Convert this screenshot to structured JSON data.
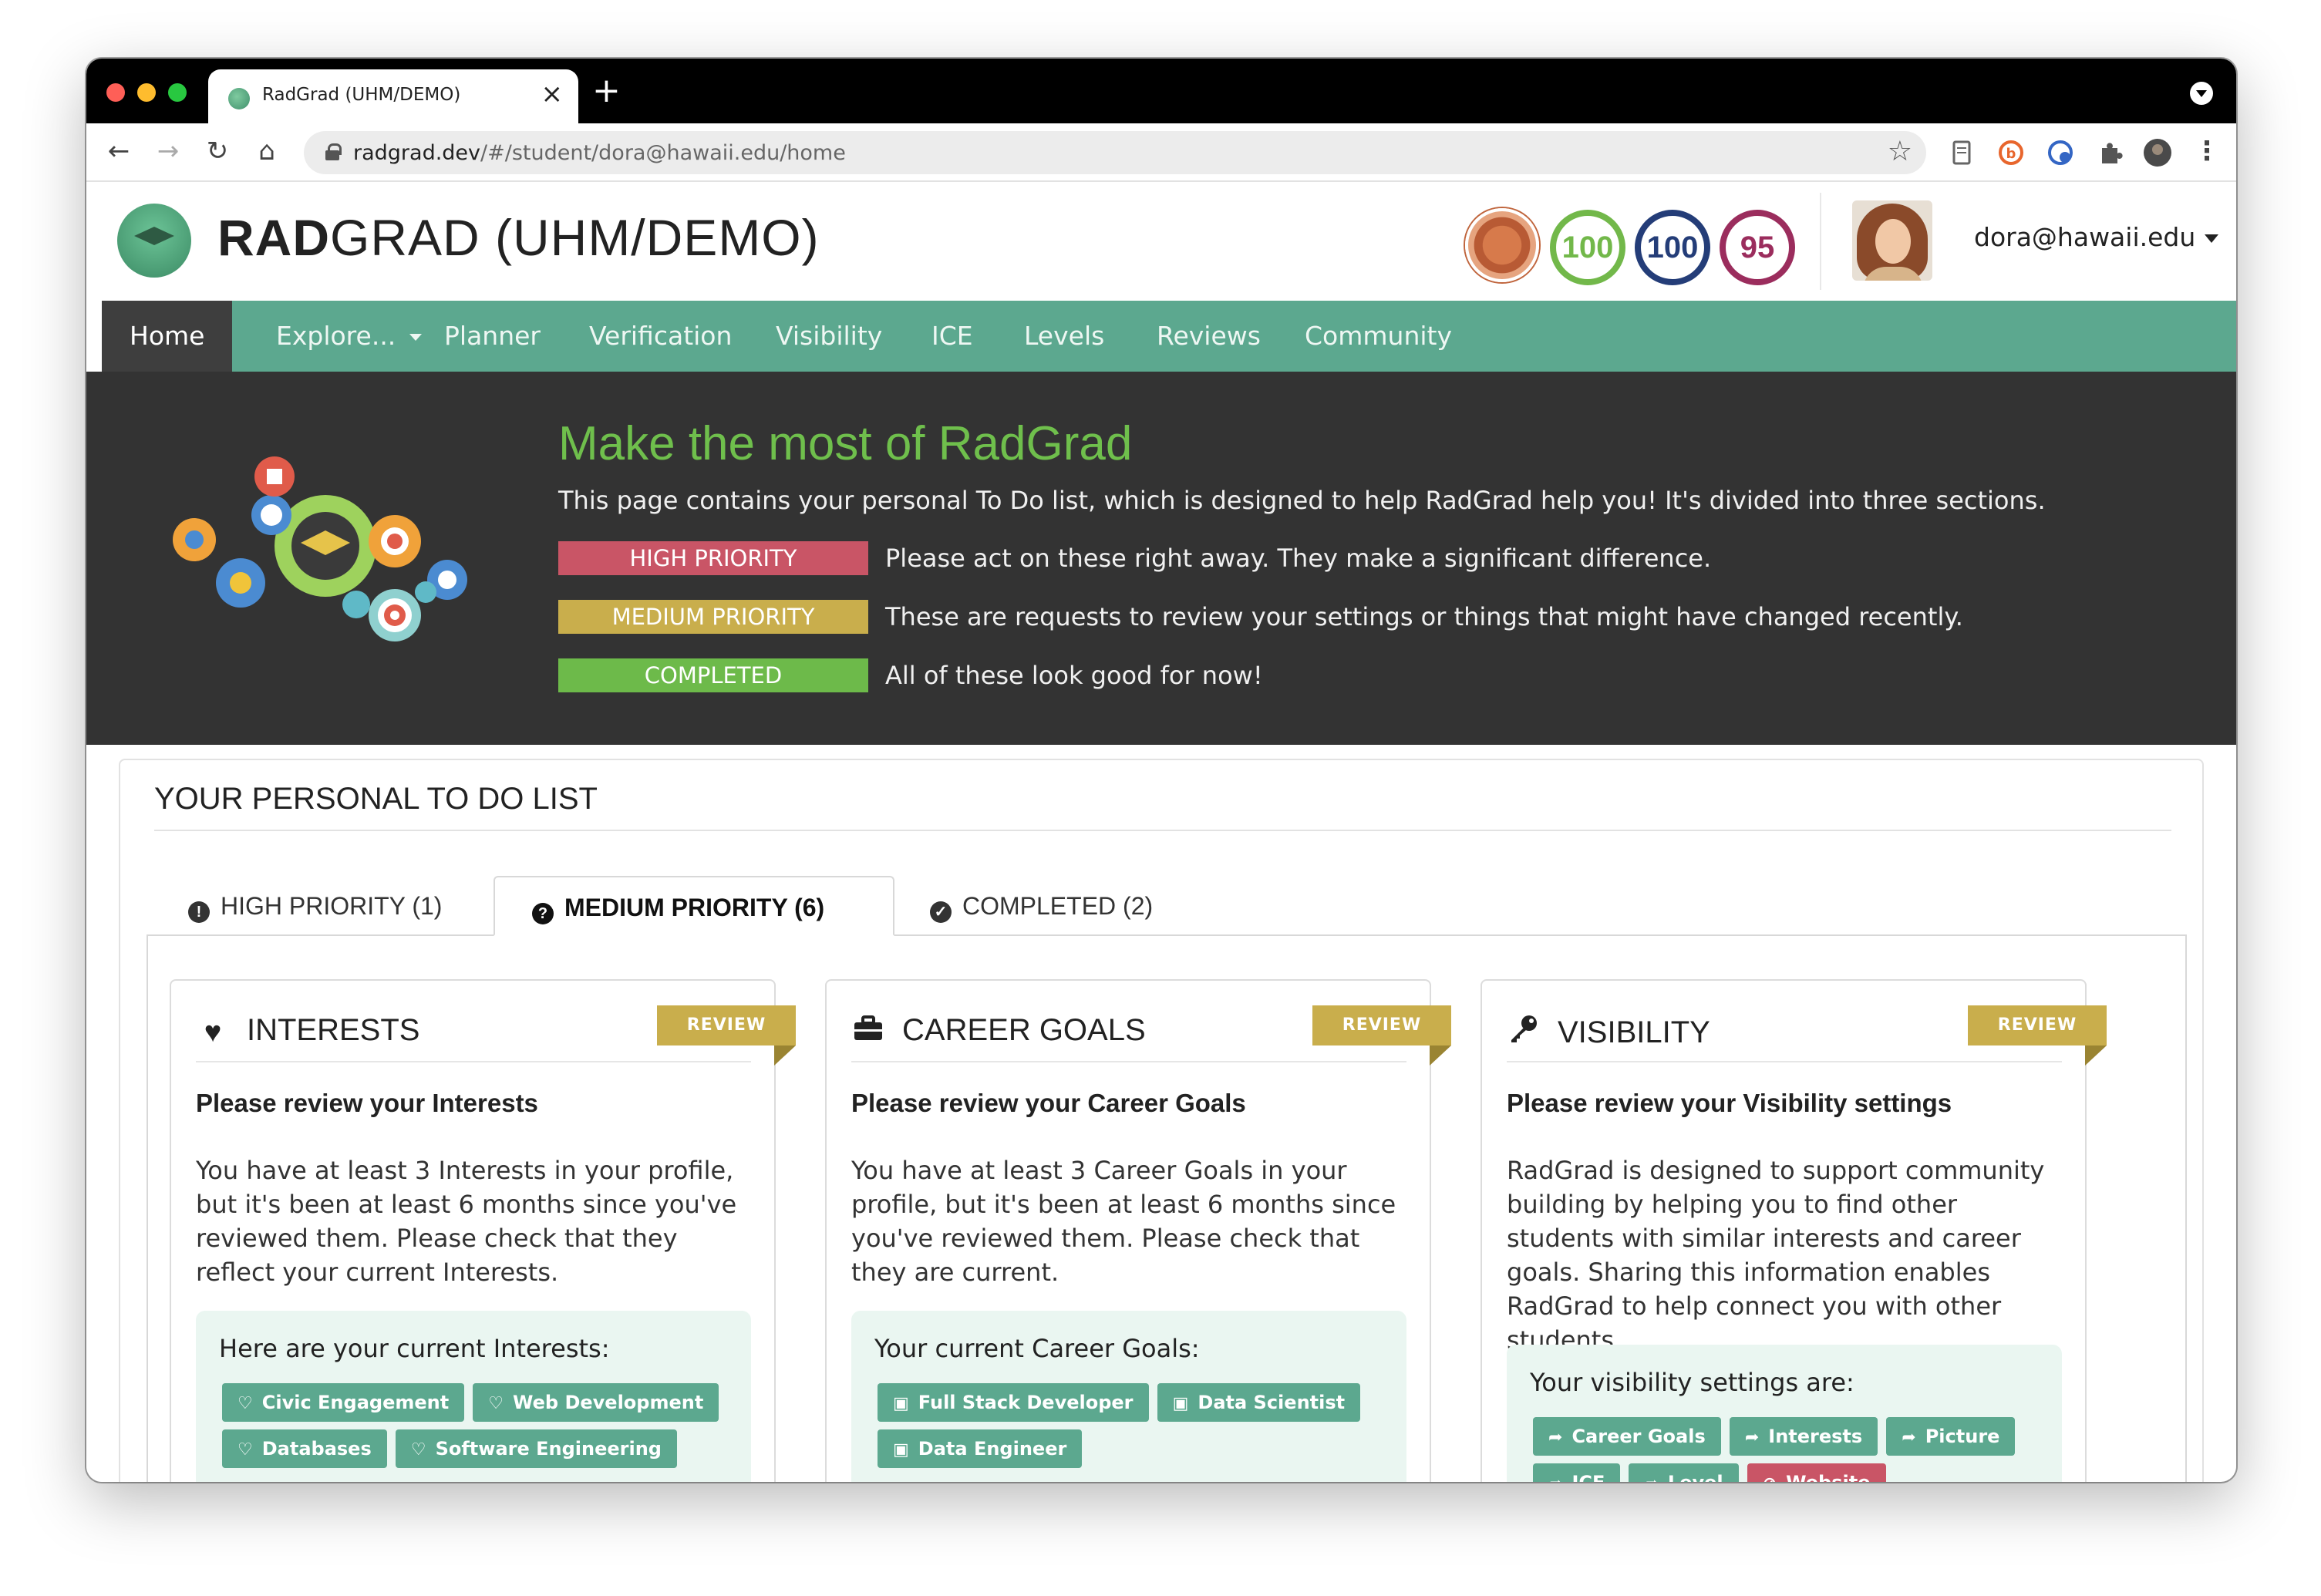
{
  "browser": {
    "tab_title": "RadGrad (UHM/DEMO)",
    "tab_close": "×",
    "new_tab": "+",
    "url_host": "radgrad.dev",
    "url_path": "/#/student/dora@hawaii.edu/home",
    "star": "☆"
  },
  "header": {
    "title_bold": "RAD",
    "title_rest": "GRAD (UHM/DEMO)",
    "ice": {
      "innovation": "100",
      "competency": "100",
      "experience": "95"
    },
    "ice_colors": {
      "innovation": "#72b84a",
      "competency": "#243d78",
      "experience": "#9b2d5d"
    },
    "user": "dora@hawaii.edu"
  },
  "nav": {
    "items": [
      "Home",
      "Explore...",
      "Planner",
      "Verification",
      "Visibility",
      "ICE",
      "Levels",
      "Reviews",
      "Community"
    ],
    "active": "Home"
  },
  "hero": {
    "title": "Make the most of RadGrad",
    "subtitle": "This page contains your personal To Do list, which is designed to help RadGrad help you! It's divided into three sections.",
    "priorities": [
      {
        "label": "HIGH PRIORITY",
        "desc": "Please act on these right away. They make a significant difference.",
        "color": "#c95566"
      },
      {
        "label": "MEDIUM PRIORITY",
        "desc": "These are requests to review your settings or things that might have changed recently.",
        "color": "#c9ae4c"
      },
      {
        "label": "COMPLETED",
        "desc": "All of these look good for now!",
        "color": "#6dba4a"
      }
    ]
  },
  "todo": {
    "title": "YOUR PERSONAL TO DO LIST",
    "tabs": [
      {
        "label": "HIGH PRIORITY (1)",
        "icon": "!"
      },
      {
        "label": "MEDIUM PRIORITY (6)",
        "icon": "?"
      },
      {
        "label": "COMPLETED (2)",
        "icon": "✓"
      }
    ],
    "active_tab": "MEDIUM PRIORITY (6)",
    "cards": [
      {
        "heading": "INTERESTS",
        "icon": "heart-icon",
        "ribbon": "REVIEW",
        "subheading": "Please review your Interests",
        "text": "You have at least 3 Interests in your profile, but it's been at least 6 months since you've reviewed them. Please check that they reflect your current Interests.",
        "box_label": "Here are your current Interests:",
        "chips": [
          "Civic Engagement",
          "Web Development",
          "Databases",
          "Software Engineering"
        ]
      },
      {
        "heading": "CAREER GOALS",
        "icon": "briefcase-icon",
        "ribbon": "REVIEW",
        "subheading": "Please review your Career Goals",
        "text": "You have at least 3 Career Goals in your profile, but it's been at least 6 months since you've reviewed them. Please check that they are current.",
        "box_label": "Your current Career Goals:",
        "chips": [
          "Full Stack Developer",
          "Data Scientist",
          "Data Engineer"
        ]
      },
      {
        "heading": "VISIBILITY",
        "icon": "key-icon",
        "ribbon": "REVIEW",
        "subheading": "Please review your Visibility settings",
        "text": "RadGrad is designed to support community building by helping you to find other students with similar interests and career goals. Sharing this information enables RadGrad to help connect you with other students.",
        "box_label": "Your visibility settings are:",
        "chips": [
          "Career Goals",
          "Interests",
          "Picture",
          "ICE",
          "Level",
          "Website"
        ]
      }
    ]
  }
}
